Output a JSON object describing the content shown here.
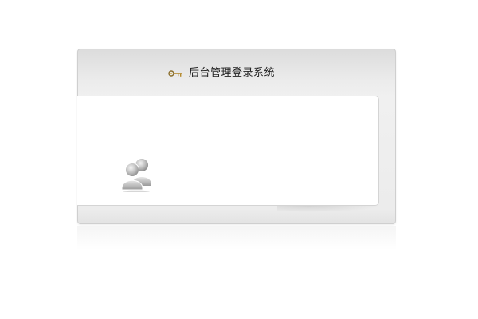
{
  "login": {
    "title": "后台管理登录系统"
  },
  "icons": {
    "title_icon": "key-icon",
    "user_icon": "users-icon"
  },
  "colors": {
    "panel_background": "#ececec",
    "panel_border": "#cfcfcf",
    "content_background": "#ffffff",
    "title_text": "#222222"
  }
}
